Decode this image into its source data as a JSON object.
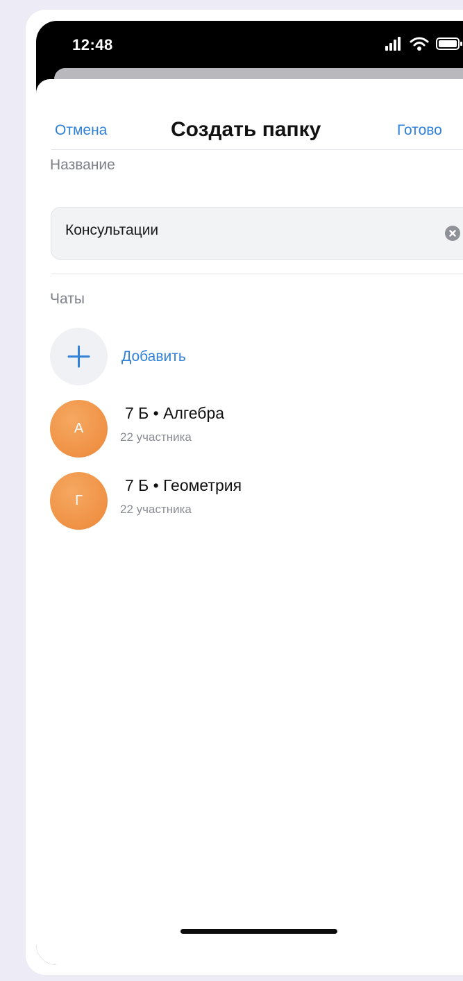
{
  "status_bar": {
    "time": "12:48",
    "icons": [
      "signal-icon",
      "wifi-icon",
      "battery-icon"
    ]
  },
  "nav": {
    "cancel_label": "Отмена",
    "title": "Создать папку",
    "done_label": "Готово"
  },
  "name_section": {
    "label": "Название",
    "value": "Консультации",
    "clear_icon": "clear-icon"
  },
  "chats_section": {
    "label": "Чаты",
    "add_label": "Добавить",
    "add_icon": "plus-icon",
    "items": [
      {
        "avatar_letter": "А",
        "title": "7 Б • Алгебра",
        "subtitle": "22 участника"
      },
      {
        "avatar_letter": "Г",
        "title": "7 Б • Геометрия",
        "subtitle": "22 участника"
      }
    ]
  },
  "colors": {
    "accent": "#2e80d8",
    "avatar": "#ec8838",
    "background": "#ecebf6"
  }
}
